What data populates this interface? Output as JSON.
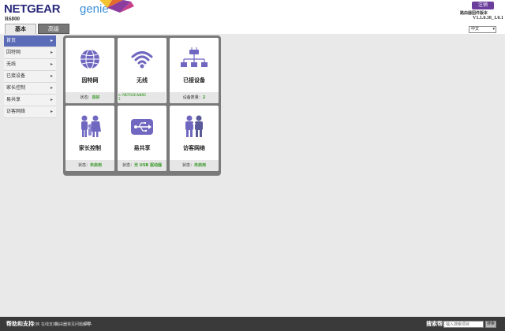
{
  "header": {
    "brand": "NETGEAR",
    "genie": "genie",
    "model": "R6800",
    "tabs": {
      "basic": "基本",
      "advanced": "高级"
    },
    "logout": "注销",
    "firmware_label": "路由器固件版本",
    "firmware_version": "V1.1.0.38_1.0.1",
    "language": "中文"
  },
  "sidebar": {
    "items": [
      {
        "label": "首页",
        "active": true
      },
      {
        "label": "因特网"
      },
      {
        "label": "无线"
      },
      {
        "label": "已接设备"
      },
      {
        "label": "家长控制"
      },
      {
        "label": "易共享"
      },
      {
        "label": "访客网络"
      }
    ]
  },
  "tiles": {
    "internet": {
      "title": "因特网",
      "status_label": "状态：",
      "status_value": "良好",
      "icon": "globe-icon"
    },
    "wireless": {
      "title": "无线",
      "ssid": "r: NETGEAR95",
      "ssid_line2": "5",
      "icon": "wifi-icon"
    },
    "devices": {
      "title": "已接设备",
      "status_label": "设备数量：",
      "status_value": "2",
      "icon": "network-devices-icon"
    },
    "parental": {
      "title": "家长控制",
      "status_label": "状态：",
      "status_value": "未启用",
      "icon": "family-icon"
    },
    "readyshare": {
      "title": "易共享",
      "status_label": "状态：",
      "status_value": "无 USB 驱动器",
      "icon": "usb-icon"
    },
    "guest": {
      "title": "访客网络",
      "status_label": "状态：",
      "status_value": "未启用",
      "icon": "guest-people-icon"
    }
  },
  "footer": {
    "title": "帮助和支持",
    "links": [
      "文档",
      "在线支持",
      "路由器常见问题解答",
      "GPL"
    ],
    "search_label": "搜索帮助",
    "search_placeholder": "输入搜索项目",
    "search_button": "搜索"
  },
  "colors": {
    "accent_purple": "#6b3e9c",
    "status_green": "#3a9a2a",
    "icon_purple": "#7068c0",
    "sidebar_active": "#5a6bb8"
  }
}
